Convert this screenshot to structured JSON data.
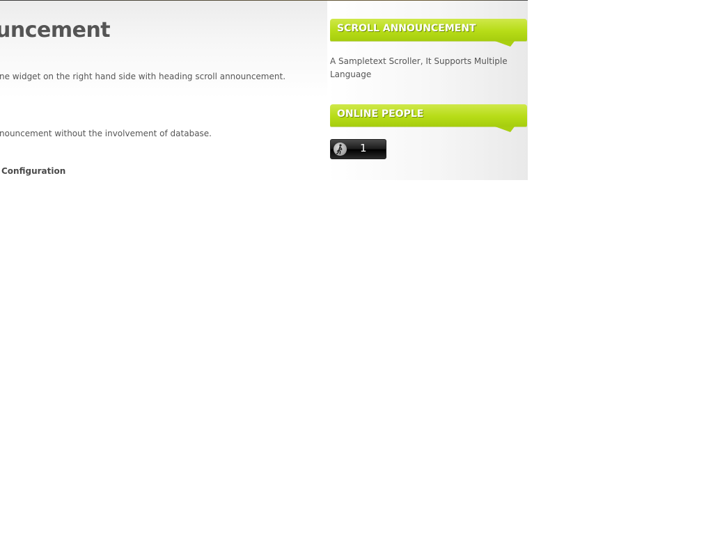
{
  "article": {
    "title": "uncement",
    "paragraph_1": "ne widget on the right hand side with heading scroll announcement.",
    "paragraph_2": "nouncement without the involvement of database.",
    "config_link": "Configuration"
  },
  "sidebar": {
    "scroll_widget": {
      "heading": "SCROLL ANNOUNCEMENT",
      "text": "A Sampletext Scroller, It Supports Multiple Language"
    },
    "online_widget": {
      "heading": "ONLINE PEOPLE",
      "count": "1",
      "icon": "walking-person-icon"
    }
  },
  "colors": {
    "accent_green": "#b7dc17",
    "text_gray": "#555555"
  }
}
